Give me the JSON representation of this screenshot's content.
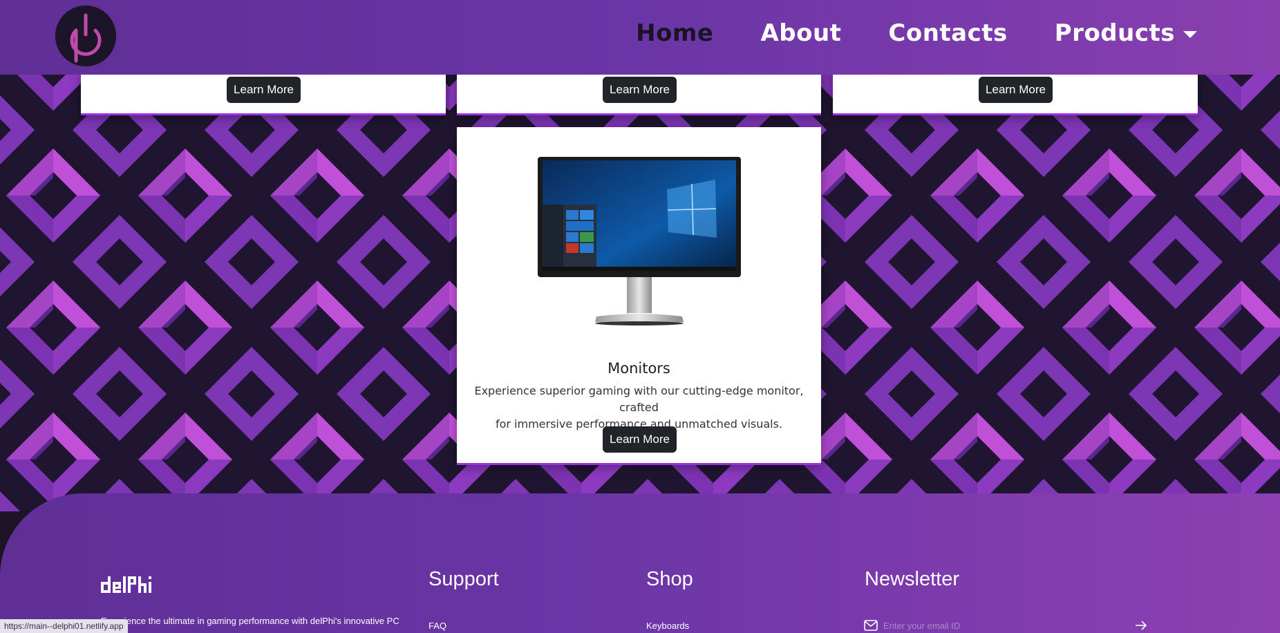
{
  "header": {
    "nav": [
      {
        "label": "Home",
        "active": true
      },
      {
        "label": "About"
      },
      {
        "label": "Contacts"
      },
      {
        "label": "Products"
      }
    ]
  },
  "cards_top": [
    {
      "button": "Learn More"
    },
    {
      "button": "Learn More"
    },
    {
      "button": "Learn More"
    }
  ],
  "card_monitors": {
    "title": "Monitors",
    "text_line1": "Experience superior gaming with our cutting-edge monitor, crafted",
    "text_line2": "for immersive performance and unmatched visuals.",
    "button": "Learn More"
  },
  "footer": {
    "logo_text": "delPhi",
    "description": "Experience the ultimate in gaming performance with delPhi's innovative PC",
    "support": {
      "heading": "Support",
      "links": [
        "FAQ"
      ]
    },
    "shop": {
      "heading": "Shop",
      "links": [
        "Keyboards"
      ]
    },
    "newsletter": {
      "heading": "Newsletter",
      "placeholder": "Enter your email ID"
    }
  },
  "status_bar": {
    "url": "https://main--delphi01.netlify.app"
  },
  "colors": {
    "accent": "#9a2fe0",
    "header_start": "#5f2f96",
    "header_end": "#8a3fb0",
    "button": "#212529"
  }
}
